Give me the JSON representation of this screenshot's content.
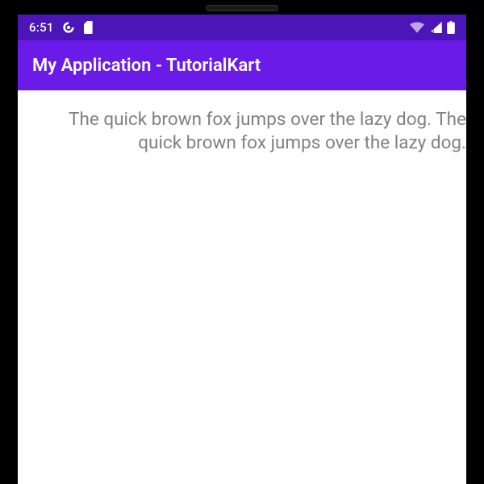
{
  "status_bar": {
    "time": "6:51"
  },
  "app_bar": {
    "title": "My Application - TutorialKart"
  },
  "content": {
    "text": "The quick brown fox jumps over the lazy dog. The quick brown fox jumps over the lazy dog."
  }
}
